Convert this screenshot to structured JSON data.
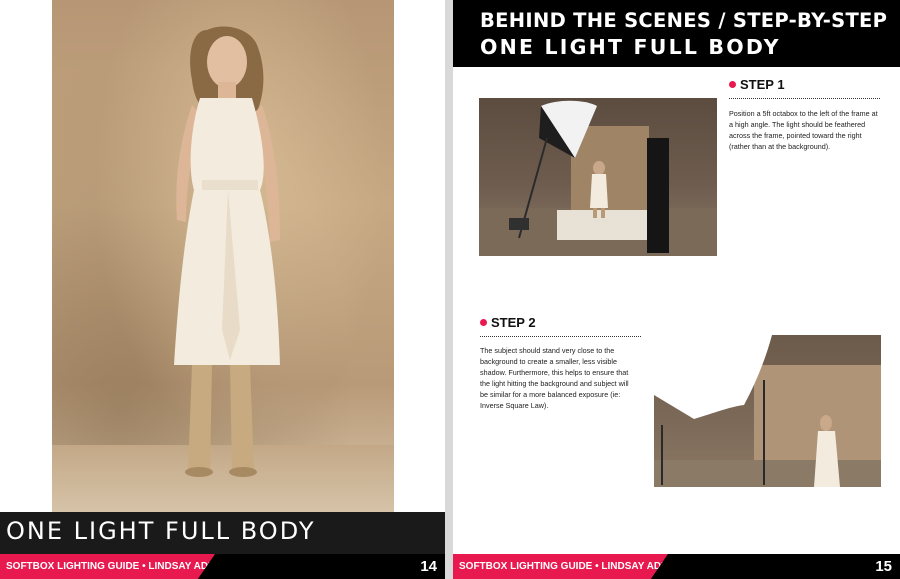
{
  "left_page": {
    "title": "ONE LIGHT FULL BODY",
    "footer_text": "SOFTBOX LIGHTING GUIDE  •  LINDSAY ADLER",
    "page_number": "14"
  },
  "right_page": {
    "header_title": "BEHIND THE SCENES / STEP-BY-STEP",
    "header_subtitle": "ONE LIGHT FULL BODY",
    "steps": [
      {
        "label": "STEP 1",
        "text": "Position a 5ft octabox to the left of the frame at a high angle. The light should be feathered across the frame, pointed toward the right (rather than at the background)."
      },
      {
        "label": "STEP 2",
        "text": "The subject should stand very close to the background to create a smaller, less visible shadow. Furthermore, this helps to ensure that the light hitting the background and subject will be similar for a more balanced exposure (ie: Inverse Square Law)."
      }
    ],
    "footer_text": "SOFTBOX LIGHTING GUIDE  •  LINDSAY ADLER",
    "page_number": "15"
  },
  "colors": {
    "accent_pink": "#e8194f",
    "band_black": "#000000"
  }
}
